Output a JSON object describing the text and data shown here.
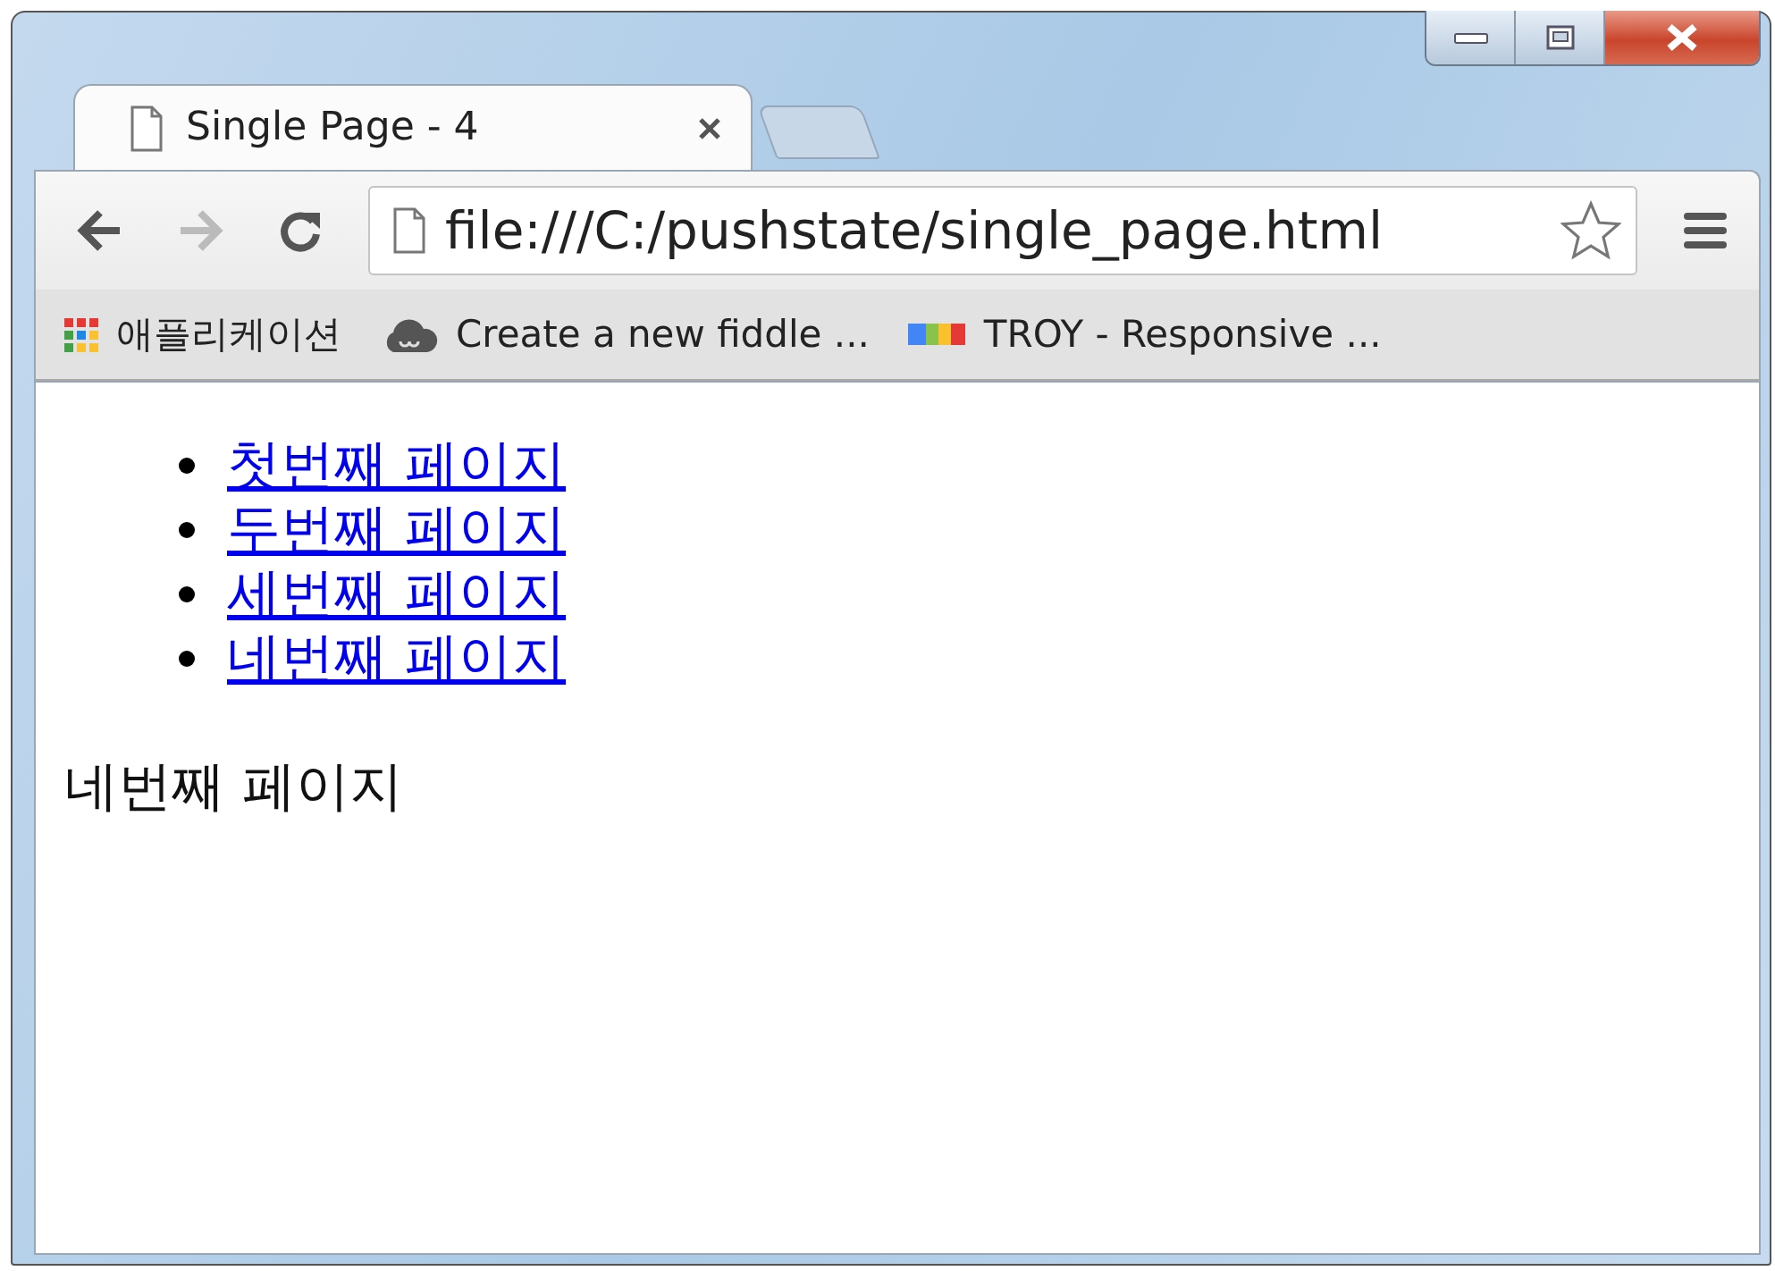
{
  "tabs": [
    {
      "title": "Single Page - 4",
      "selected": true
    },
    {
      "selected": false
    }
  ],
  "toolbar": {
    "back_disabled": false,
    "forward_disabled": true,
    "url": "file:///C:/pushstate/single_page.html",
    "bookmarked": false
  },
  "bookmarks": [
    {
      "kind": "apps",
      "label": "애플리케이션"
    },
    {
      "kind": "cloud",
      "label": "Create a new fiddle ..."
    },
    {
      "kind": "stripes",
      "label": "TROY - Responsive ..."
    }
  ],
  "page": {
    "links": [
      "첫번째 페이지",
      "두번째 페이지",
      "세번째 페이지",
      "네번째 페이지"
    ],
    "text": "네번째 페이지"
  }
}
